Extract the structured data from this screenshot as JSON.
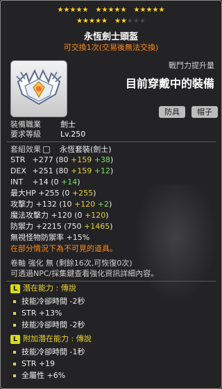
{
  "stars": {
    "row1_filled": 18,
    "row1_total": 18,
    "row2_filled": 7,
    "row2_total": 10
  },
  "item": {
    "name": "永恆劍士頭盔",
    "tradeable": "可交換1次(交易後無法交換)"
  },
  "combat": {
    "label": "戰鬥力提升量",
    "value": "目前穿戴中的裝備"
  },
  "badges": [
    "防具",
    "帽子"
  ],
  "requirements": [
    {
      "label": "裝備職業",
      "value": "劍士"
    },
    {
      "label": "要求等級",
      "value": "Lv.250"
    }
  ],
  "set": {
    "label": "套組效果",
    "value": "永恆套裝(劍士)"
  },
  "stats": [
    {
      "label": "STR",
      "total": " +277",
      "base": "80",
      "scroll": "+159",
      "bonus": "+38"
    },
    {
      "label": "DEX",
      "total": " +251",
      "base": "80",
      "scroll": "+159",
      "bonus": "+12"
    },
    {
      "label": "INT",
      "total": " +14",
      "base": "0",
      "scroll": "",
      "bonus": "+14"
    },
    {
      "label": "最大HP",
      "total": " +255",
      "base": "0",
      "scroll": "+255",
      "bonus": ""
    },
    {
      "label": "攻擊力",
      "total": " +132",
      "base": "10",
      "scroll": "+120",
      "bonus": "+2"
    },
    {
      "label": "魔法攻擊力",
      "total": " +120",
      "base": "0",
      "scroll": "+120",
      "bonus": ""
    },
    {
      "label": "防禦力",
      "total": " +2215",
      "base": "750",
      "scroll": "+1465",
      "bonus": ""
    }
  ],
  "ignore_def": {
    "label": "無視怪物防禦率",
    "value": "+15%"
  },
  "warning": "在部分情況下為不可見的道具。",
  "scroll_info": "卷軸 強化 無 (剩餘16次,可恢復0次)",
  "npc_info": "可透過NPC/採集鍵查看強化資訊詳細內容。",
  "potential": {
    "tag": "L",
    "title": "潛在能力 : 傳說",
    "lines": [
      "技能冷卻時間 -2秒",
      "STR +13%",
      "技能冷卻時間 -2秒"
    ]
  },
  "bonus_potential": {
    "tag": "L",
    "title": "附加潛在能力 : 傳說",
    "lines": [
      "技能冷卻時間 -1秒",
      "STR +19",
      "全屬性 +6%"
    ]
  },
  "colors": {
    "accent_orange": "#ff8a1d",
    "scroll_yellow": "#e9d336",
    "bonus_green": "#79e26b",
    "star_gold": "#ffd21a"
  }
}
